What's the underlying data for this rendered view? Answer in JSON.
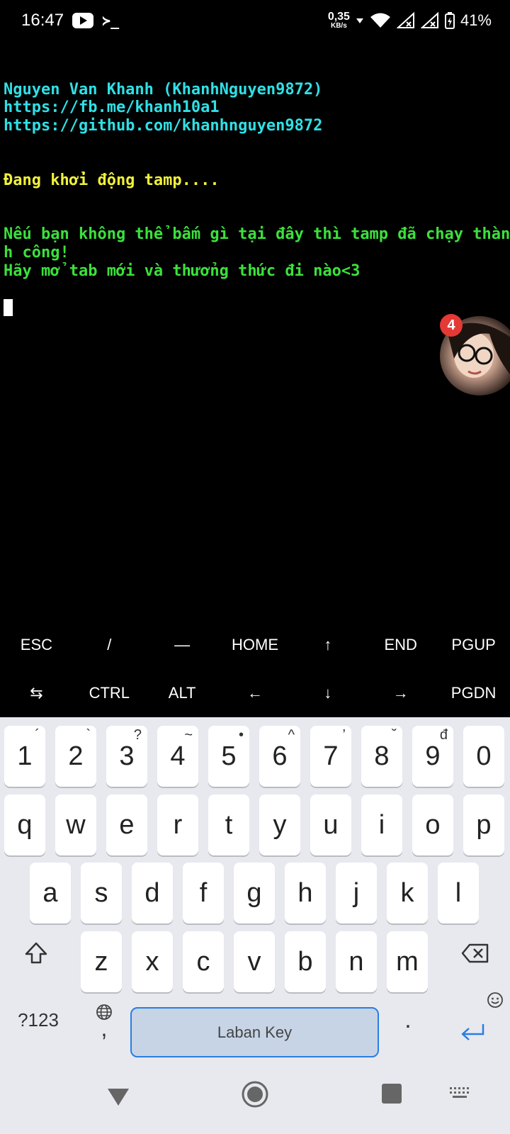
{
  "status_bar": {
    "time": "16:47",
    "net_speed": "0,35",
    "net_unit": "KB/s",
    "battery_pct": "41%",
    "term_glyph": "≻_"
  },
  "terminal": {
    "lines": [
      {
        "text": "",
        "color": "cyan"
      },
      {
        "text": "Nguyen Van Khanh (KhanhNguyen9872)",
        "color": "cyan"
      },
      {
        "text": "https://fb.me/khanh10a1",
        "color": "cyan"
      },
      {
        "text": "https://github.com/khanhnguyen9872",
        "color": "cyan"
      },
      {
        "text": "",
        "color": "cyan"
      },
      {
        "text": "",
        "color": "cyan"
      },
      {
        "text": "Đang khởi động tamp....",
        "color": "yellow"
      },
      {
        "text": "",
        "color": "cyan"
      },
      {
        "text": "",
        "color": "cyan"
      },
      {
        "text": "Nếu bạn không thể bấm gì tại đây thì tamp đã chạy thàn",
        "color": "green"
      },
      {
        "text": "h công!",
        "color": "green"
      },
      {
        "text": "Hãy mở tab mới và thưởng thức đi nào<3",
        "color": "green"
      }
    ]
  },
  "chat_head": {
    "badge_count": "4"
  },
  "extra_keys": {
    "row1": [
      "ESC",
      "/",
      "—",
      "HOME",
      "↑",
      "END",
      "PGUP"
    ],
    "row2": [
      "⇆",
      "CTRL",
      "ALT",
      "←",
      "↓",
      "→",
      "PGDN"
    ]
  },
  "keyboard": {
    "row_numbers": [
      {
        "k": "1",
        "h": "´"
      },
      {
        "k": "2",
        "h": "`"
      },
      {
        "k": "3",
        "h": "?"
      },
      {
        "k": "4",
        "h": "~"
      },
      {
        "k": "5",
        "h": "•"
      },
      {
        "k": "6",
        "h": "^"
      },
      {
        "k": "7",
        "h": "’"
      },
      {
        "k": "8",
        "h": "˘"
      },
      {
        "k": "9",
        "h": "đ"
      },
      {
        "k": "0",
        "h": ""
      }
    ],
    "row_q": [
      "q",
      "w",
      "e",
      "r",
      "t",
      "y",
      "u",
      "i",
      "o",
      "p"
    ],
    "row_a": [
      "a",
      "s",
      "d",
      "f",
      "g",
      "h",
      "j",
      "k",
      "l"
    ],
    "row_z": [
      "z",
      "x",
      "c",
      "v",
      "b",
      "n",
      "m"
    ],
    "symbols_label": "?123",
    "comma_label": ",",
    "period_label": ".",
    "space_label": "Laban Key"
  }
}
